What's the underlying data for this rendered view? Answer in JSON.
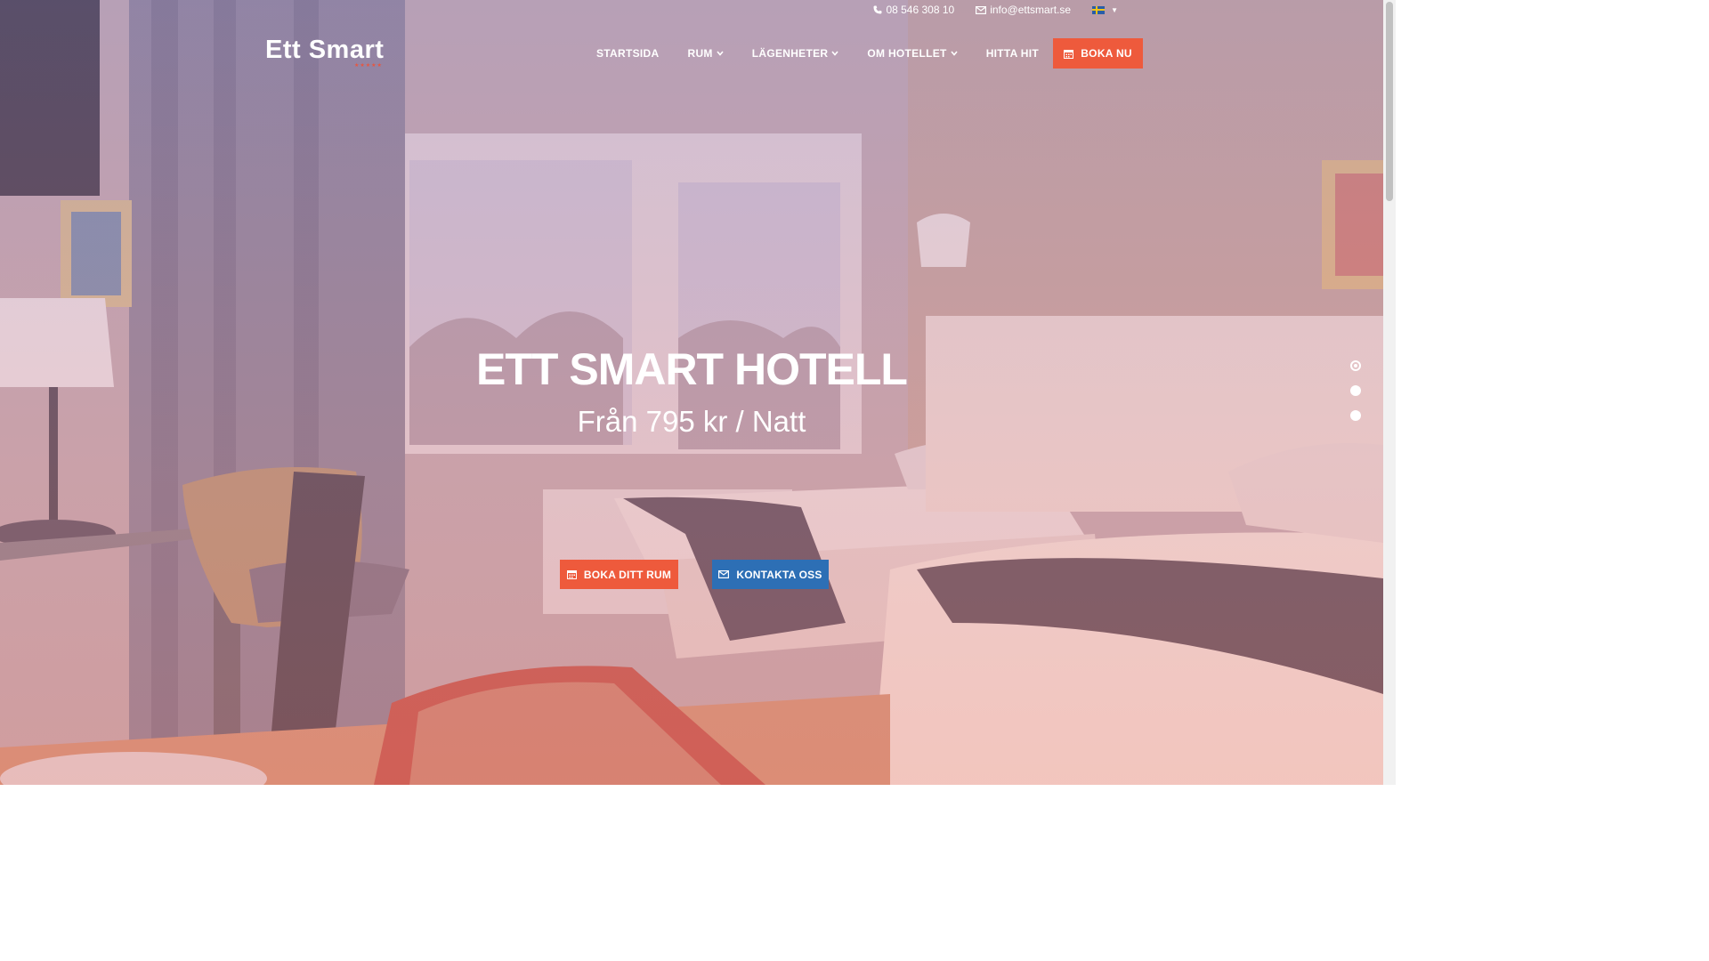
{
  "topbar": {
    "phone": "08 546 308 10",
    "email": "info@ettsmart.se",
    "language_flag_icon": "sweden-flag-icon"
  },
  "header": {
    "logo_text": "Ett Smart",
    "logo_stars": "★★★★★"
  },
  "nav": {
    "items": [
      {
        "label": "STARTSIDA",
        "has_dropdown": false
      },
      {
        "label": "RUM",
        "has_dropdown": true
      },
      {
        "label": "LÄGENHETER",
        "has_dropdown": true
      },
      {
        "label": "OM HOTELLET",
        "has_dropdown": true
      },
      {
        "label": "HITTA HIT",
        "has_dropdown": false
      }
    ],
    "cta_label": "BOKA NU"
  },
  "hero": {
    "title": "ETT SMART HOTELL",
    "subtitle": "Från 795 kr / Natt",
    "book_button": "BOKA DITT RUM",
    "contact_button": "KONTAKTA OSS"
  },
  "slider": {
    "slide_count": 3,
    "active_index": 0
  },
  "colors": {
    "accent_orange": "#ee5a3c",
    "accent_blue": "#2d6fb5"
  }
}
